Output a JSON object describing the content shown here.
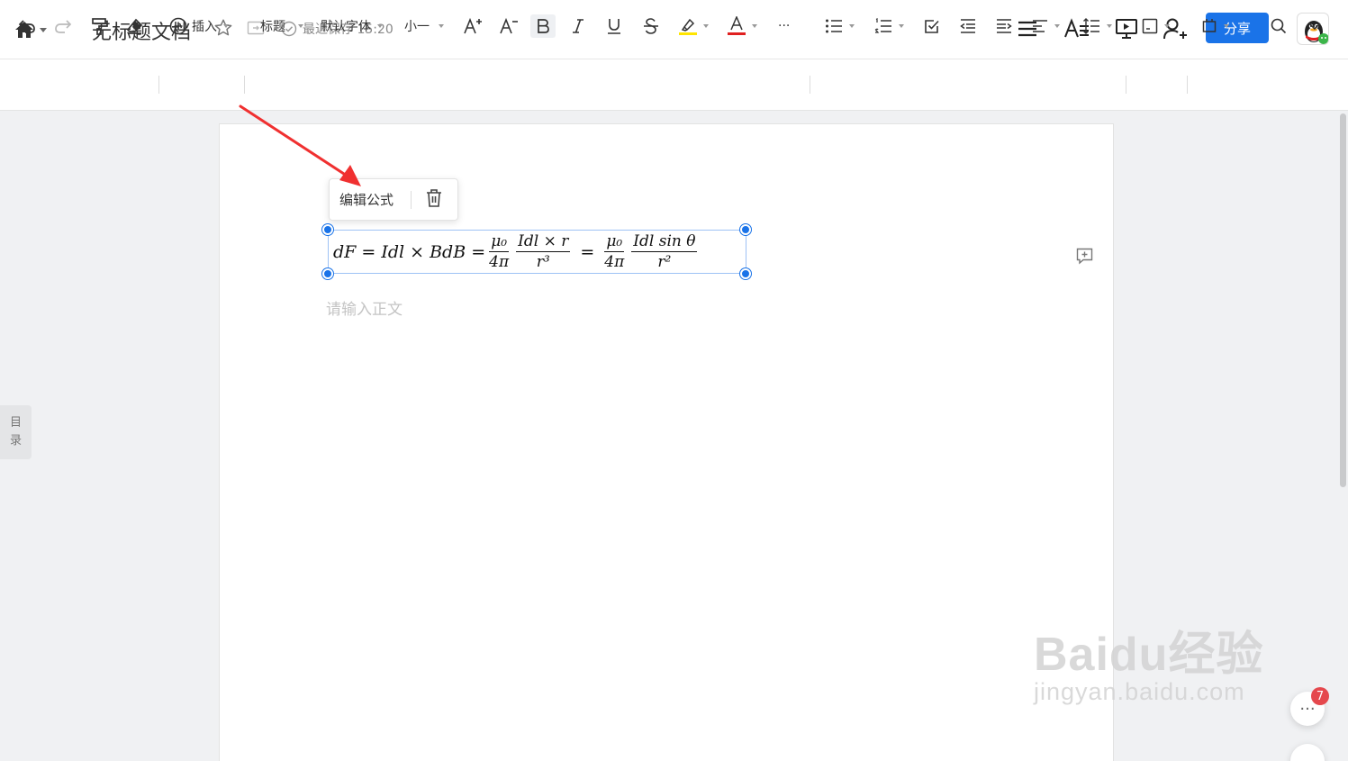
{
  "header": {
    "doc_title": "无标题文档",
    "save_status": "最近保存 15:20",
    "share_label": "分享"
  },
  "toolbar": {
    "insert_label": "插入",
    "heading_label": "标题",
    "font_label": "默认字体",
    "font_size_label": "小一",
    "more_label": "···"
  },
  "formula_popup": {
    "edit_label": "编辑公式"
  },
  "formula": {
    "lhs": "dF = Idl × BdB =",
    "frac1_num": "μ₀",
    "frac1_den": "4π",
    "frac2_num": "Idl × r",
    "frac2_den": "r³",
    "equals": "=",
    "frac3_num": "μ₀",
    "frac3_den": "4π",
    "frac4_num": "Idl sin θ",
    "frac4_den": "r²"
  },
  "editor": {
    "placeholder": "请输入正文"
  },
  "sidebar": {
    "toc_label_1": "目",
    "toc_label_2": "录"
  },
  "watermark": {
    "main": "Baidu经验",
    "sub": "jingyan.baidu.com"
  },
  "notification_count": "7",
  "colors": {
    "accent": "#1a73e8",
    "highlight": "#ffe500",
    "font_color": "#e02020",
    "arrow": "#f03030"
  }
}
